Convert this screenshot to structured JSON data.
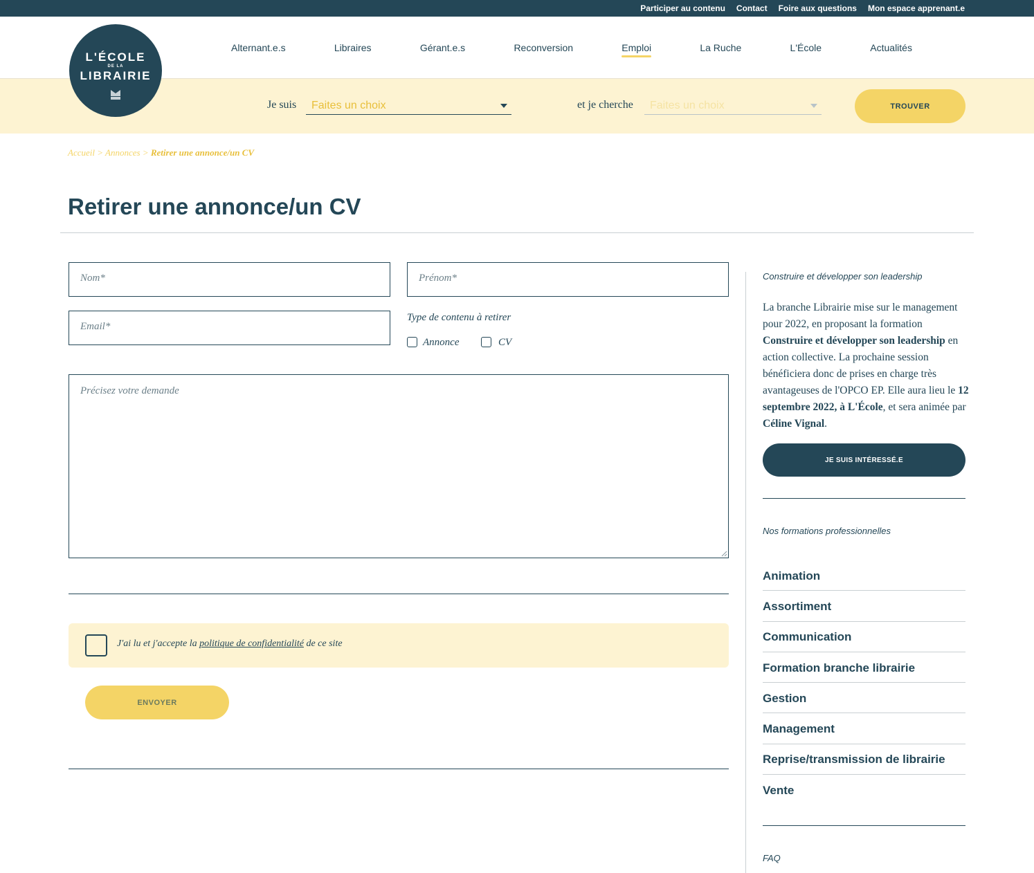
{
  "topbar": {
    "links": [
      "Participer au contenu",
      "Contact",
      "Foire aux questions",
      "Mon espace apprenant.e"
    ]
  },
  "logo": {
    "line1": "L'ÉCOLE",
    "line2": "DE LA",
    "line3": "LIBRAIRIE"
  },
  "nav": {
    "items": [
      "Alternant.e.s",
      "Libraires",
      "Gérant.e.s",
      "Reconversion",
      "Emploi",
      "La Ruche",
      "L'École",
      "Actualités"
    ],
    "active": "Emploi"
  },
  "search": {
    "label1": "Je suis",
    "select1": "Faites un choix",
    "label2": "et je cherche",
    "select2": "Faites un choix",
    "button": "TROUVER"
  },
  "breadcrumb": {
    "home": "Accueil",
    "sep": ">",
    "section": "Annonces",
    "current": "Retirer une annonce/un CV"
  },
  "page": {
    "title": "Retirer une annonce/un CV"
  },
  "form": {
    "nom_placeholder": "Nom*",
    "prenom_placeholder": "Prénom*",
    "email_placeholder": "Email*",
    "type_label": "Type de contenu à retirer",
    "option_annonce": "Annonce",
    "option_cv": "CV",
    "message_placeholder": "Précisez votre demande",
    "consent_before": "J'ai lu et j'accepte la",
    "consent_link": "politique de confidentialité",
    "consent_after": "de ce site",
    "submit": "ENVOYER"
  },
  "aside": {
    "promo_kicker": "Construire et développer son leadership",
    "promo_p1": "La branche Librairie mise sur le management pour 2022, en proposant la formation",
    "promo_b1": "Construire et développer son leadership",
    "promo_p2": "en action collective. La prochaine session bénéficiera donc de prises en charge très avantageuses de l'OPCO EP. Elle aura lieu le",
    "promo_b2": "12 septembre 2022, à L'École",
    "promo_p3": ", et sera animée par",
    "promo_b3": "Céline Vignal",
    "promo_p4": ".",
    "promo_button": "JE SUIS INTÉRESSÉ.E",
    "formations_kicker": "Nos formations professionnelles",
    "formations": [
      "Animation",
      "Assortiment",
      "Communication",
      "Formation branche librairie",
      "Gestion",
      "Management",
      "Reprise/transmission de librairie",
      "Vente"
    ],
    "faq": "FAQ"
  },
  "colors": {
    "navy": "#244757",
    "yellow": "#f4d466",
    "cream": "#fdf3d2"
  }
}
